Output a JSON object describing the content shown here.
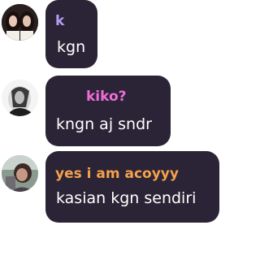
{
  "messages": [
    {
      "avatar": "profile-photo-two-girls",
      "name": "k",
      "name_color": "#b59ef7",
      "text": "kgn"
    },
    {
      "avatar": "profile-photo-monochrome",
      "name": "kiko?",
      "name_color": "#f06cdb",
      "text": "kngn aj sndr"
    },
    {
      "avatar": "profile-photo-selfie",
      "name": "yes i am acoyyy",
      "name_color": "#f4a24c",
      "text": "kasian kgn sendiri"
    }
  ],
  "colors": {
    "bubble": "#2b2436",
    "text": "#ffffff"
  }
}
